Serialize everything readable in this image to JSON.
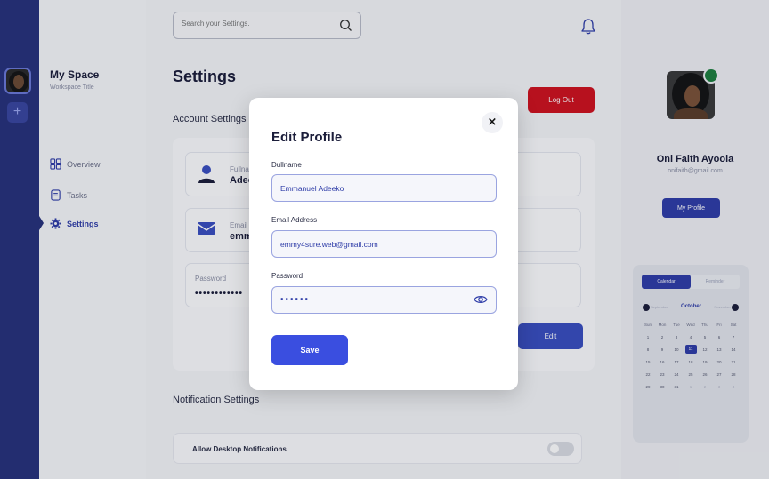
{
  "workspace": {
    "name": "My Space",
    "subtitle": "Workspace Title",
    "add_label": "+"
  },
  "nav": [
    {
      "label": "Overview",
      "icon": "grid-icon",
      "active": false
    },
    {
      "label": "Tasks",
      "icon": "task-icon",
      "active": false
    },
    {
      "label": "Settings",
      "icon": "gear-icon",
      "active": true
    }
  ],
  "search": {
    "placeholder": "Search your Settings."
  },
  "page": {
    "title": "Settings",
    "logout_label": "Log Out",
    "account_heading": "Account Settings",
    "fullname_label": "Fullname",
    "fullname_value": "Adeeko",
    "email_label": "Email",
    "email_value": "emmy",
    "password_label": "Password",
    "password_value": "••••••••••••",
    "edit_label": "Edit",
    "notification_heading": "Notification Settings",
    "desktop_notifications_label": "Allow Desktop Notifications",
    "desktop_notifications_enabled": false
  },
  "profile": {
    "name": "Oni Faith Ayoola",
    "email": "onifaith@gmail.com",
    "button_label": "My Profile",
    "status_color": "#1d7f3e"
  },
  "calendar": {
    "tabs": [
      "Calendar",
      "Reminder"
    ],
    "prev_month": "September",
    "month": "October",
    "next_month": "November",
    "day_headers": [
      "Sun",
      "Mon",
      "Tue",
      "Wed",
      "Thu",
      "Fri",
      "Sat"
    ],
    "days": [
      "1",
      "2",
      "3",
      "4",
      "5",
      "6",
      "7",
      "8",
      "9",
      "10",
      "11",
      "12",
      "13",
      "14",
      "15",
      "16",
      "17",
      "18",
      "19",
      "20",
      "21",
      "22",
      "23",
      "24",
      "25",
      "26",
      "27",
      "28",
      "29",
      "30",
      "31",
      "1",
      "2",
      "3",
      "4"
    ],
    "selected": "11"
  },
  "modal": {
    "title": "Edit Profile",
    "close_symbol": "×",
    "fullname_label": "Dullname",
    "fullname_value": "Emmanuel Adeeko",
    "email_label": "Email Address",
    "email_value": "emmy4sure.web@gmail.com",
    "password_label": "Password",
    "password_value": "••••••",
    "save_label": "Save"
  },
  "colors": {
    "rail": "#27317c",
    "accent": "#2f3da8",
    "danger": "#d0121e",
    "primary_button": "#3a4ee0"
  }
}
